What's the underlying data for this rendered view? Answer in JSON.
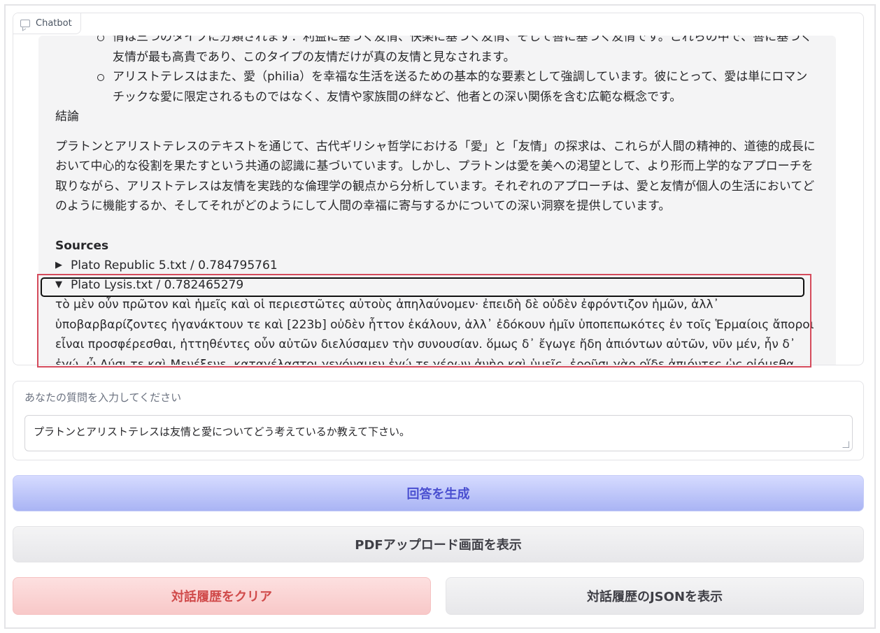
{
  "chatbot": {
    "label": "Chatbot",
    "message": {
      "bullets": [
        "情は三つのタイプに分類されます：利益に基づく友情、快楽に基づく友情、そして善に基づく友情です。これらの中で、善に基づく友情が最も高貴であり、このタイプの友情だけが真の友情と見なされます。",
        "アリストテレスはまた、愛（philia）を幸福な生活を送るための基本的な要素として強調しています。彼にとって、愛は単にロマンチックな愛に限定されるものではなく、友情や家族間の絆など、他者との深い関係を含む広範な概念です。"
      ],
      "conclusion_heading": "結論",
      "conclusion": "プラトンとアリストテレスのテキストを通じて、古代ギリシャ哲学における「愛」と「友情」の探求は、これらが人間の精神的、道徳的成長において中心的な役割を果たすという共通の認識に基づいています。しかし、プラトンは愛を美への渇望として、より形而上学的なアプローチを取りながら、アリストテレスは友情を実践的な倫理学の観点から分析しています。それぞれのアプローチは、愛と友情が個人の生活においてどのように機能するか、そしてそれがどのようにして人間の幸福に寄与するかについての深い洞察を提供しています。",
      "sources_heading": "Sources",
      "sources": [
        {
          "marker": "▶",
          "title": "Plato Republic 5.txt / 0.784795761"
        },
        {
          "marker": "▼",
          "title": "Plato Lysis.txt / 0.782465279"
        }
      ],
      "source_excerpt": "τὸ μὲν οὖν πρῶτον καὶ ἡμεῖς καὶ οἱ περιεστῶτες αὐτοὺς ἀπηλαύνομεν· ἐπειδὴ δὲ οὐδὲν ἐφρόντιζον ἡμῶν, ἀλλ᾽ ὑποβαρβαρίζοντες ἠγανάκτουν τε καὶ [223b] οὐδὲν ἧττον ἐκάλουν, ἀλλ᾽ ἐδόκουν ἡμῖν ὑποπεπωκότες ἐν τοῖς Ἑρμαίοις ἄποροι εἶναι προσφέρεσθαι, ἡττηθέντες οὖν αὐτῶν διελύσαμεν τὴν συνουσίαν. ὅμως δ᾽ ἔγωγε ἤδη ἀπιόντων αὐτῶν, νῦν μέν, ἦν δ᾽ ἐγώ, ὦ Λύσι τε καὶ Μενέξενε, καταγέλαστοι γεγόναμεν ἐγώ τε γέρων ἀνὴρ καὶ ὑμεῖς. ἐροῦσι γὰρ οἵδε ἀπιόντες ὡς οἰόμεθα ἡμεῖς"
    }
  },
  "question": {
    "label": "あなたの質問を入力してください",
    "value": "プラトンとアリストテレスは友情と愛についてどう考えているか教えて下さい。"
  },
  "buttons": {
    "generate": "回答を生成",
    "pdf": "PDFアップロード画面を表示",
    "clear": "対話履歴をクリア",
    "json": "対話履歴のJSONを表示"
  },
  "colors": {
    "highlight_box": "#d54b5c",
    "generate_text": "#4a4fd0",
    "clear_text": "#d04a4a"
  }
}
